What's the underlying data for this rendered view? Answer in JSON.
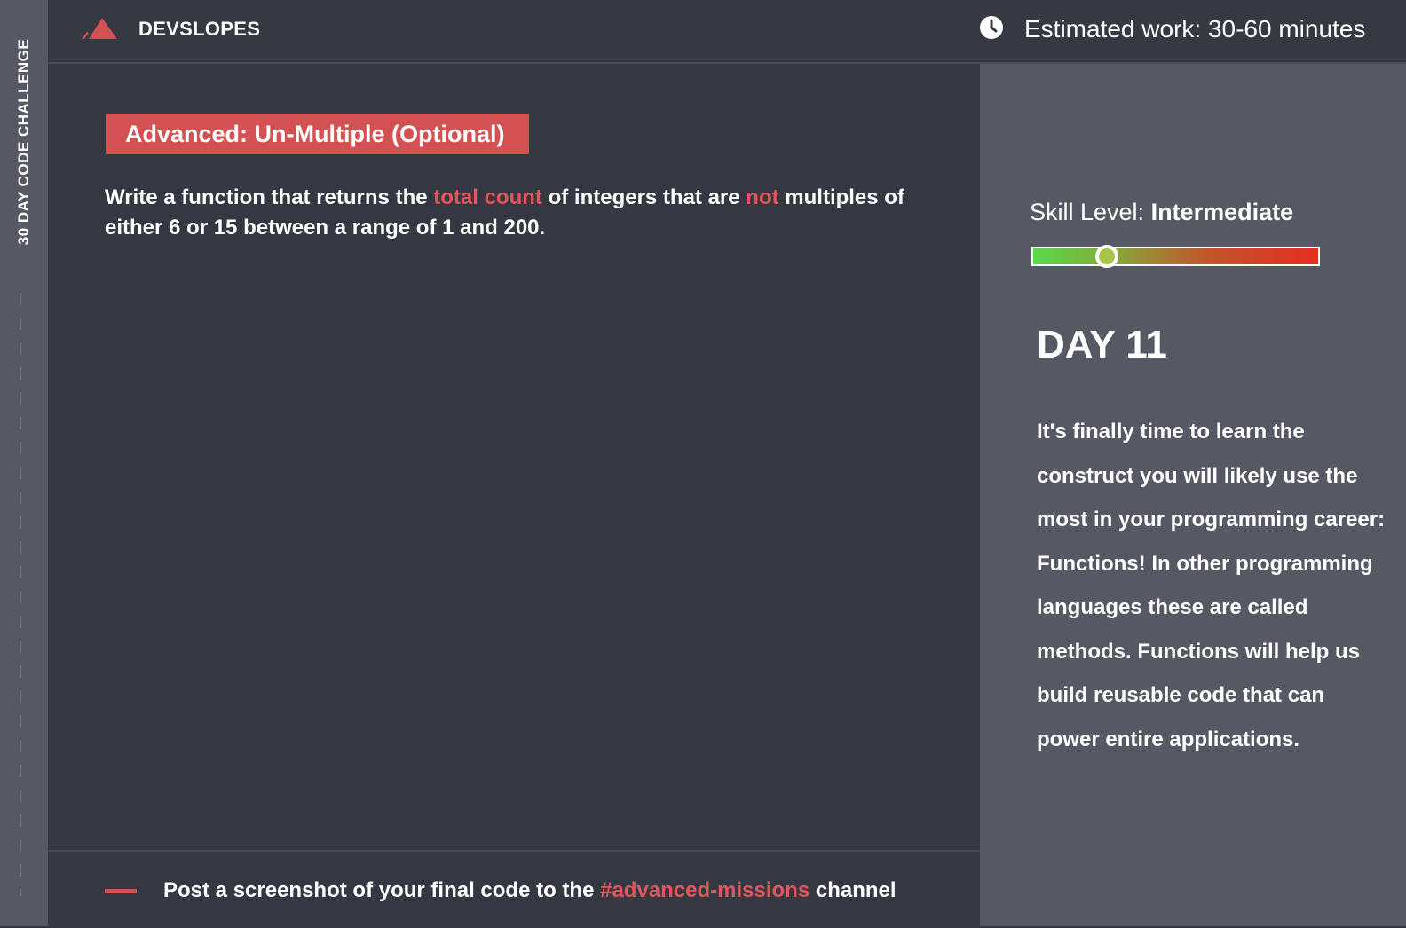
{
  "sidebar": {
    "label": "30 DAY CODE CHALLENGE"
  },
  "header": {
    "brand": "DEVSLOPES",
    "logo_icon": "devslopes-mountain-logo",
    "clock_icon": "clock-icon",
    "estimate": "Estimated work: 30-60 minutes"
  },
  "mission": {
    "title": "Advanced: Un-Multiple (Optional)",
    "description": {
      "part1": "Write a function that returns the ",
      "highlight1": "total count",
      "part2": " of integers that are ",
      "highlight2": "not",
      "part3": " multiples of either 6 or 15 between a range of 1 and 200."
    }
  },
  "footer": {
    "text_before": "Post a screenshot of your final code to the ",
    "channel": "#advanced-missions",
    "text_after": " channel"
  },
  "side": {
    "skill_label": "Skill Level: ",
    "skill_value": "Intermediate",
    "skill_meter_position": 0.26,
    "day": "DAY 11",
    "intro": "It's finally time to learn the construct you will likely use the most in your programming career: Functions! In other programming languages these are called methods. Functions will help us build reusable code that can power entire applications."
  },
  "colors": {
    "accent": "#d35152",
    "background": "#353743",
    "panel": "#565963"
  }
}
